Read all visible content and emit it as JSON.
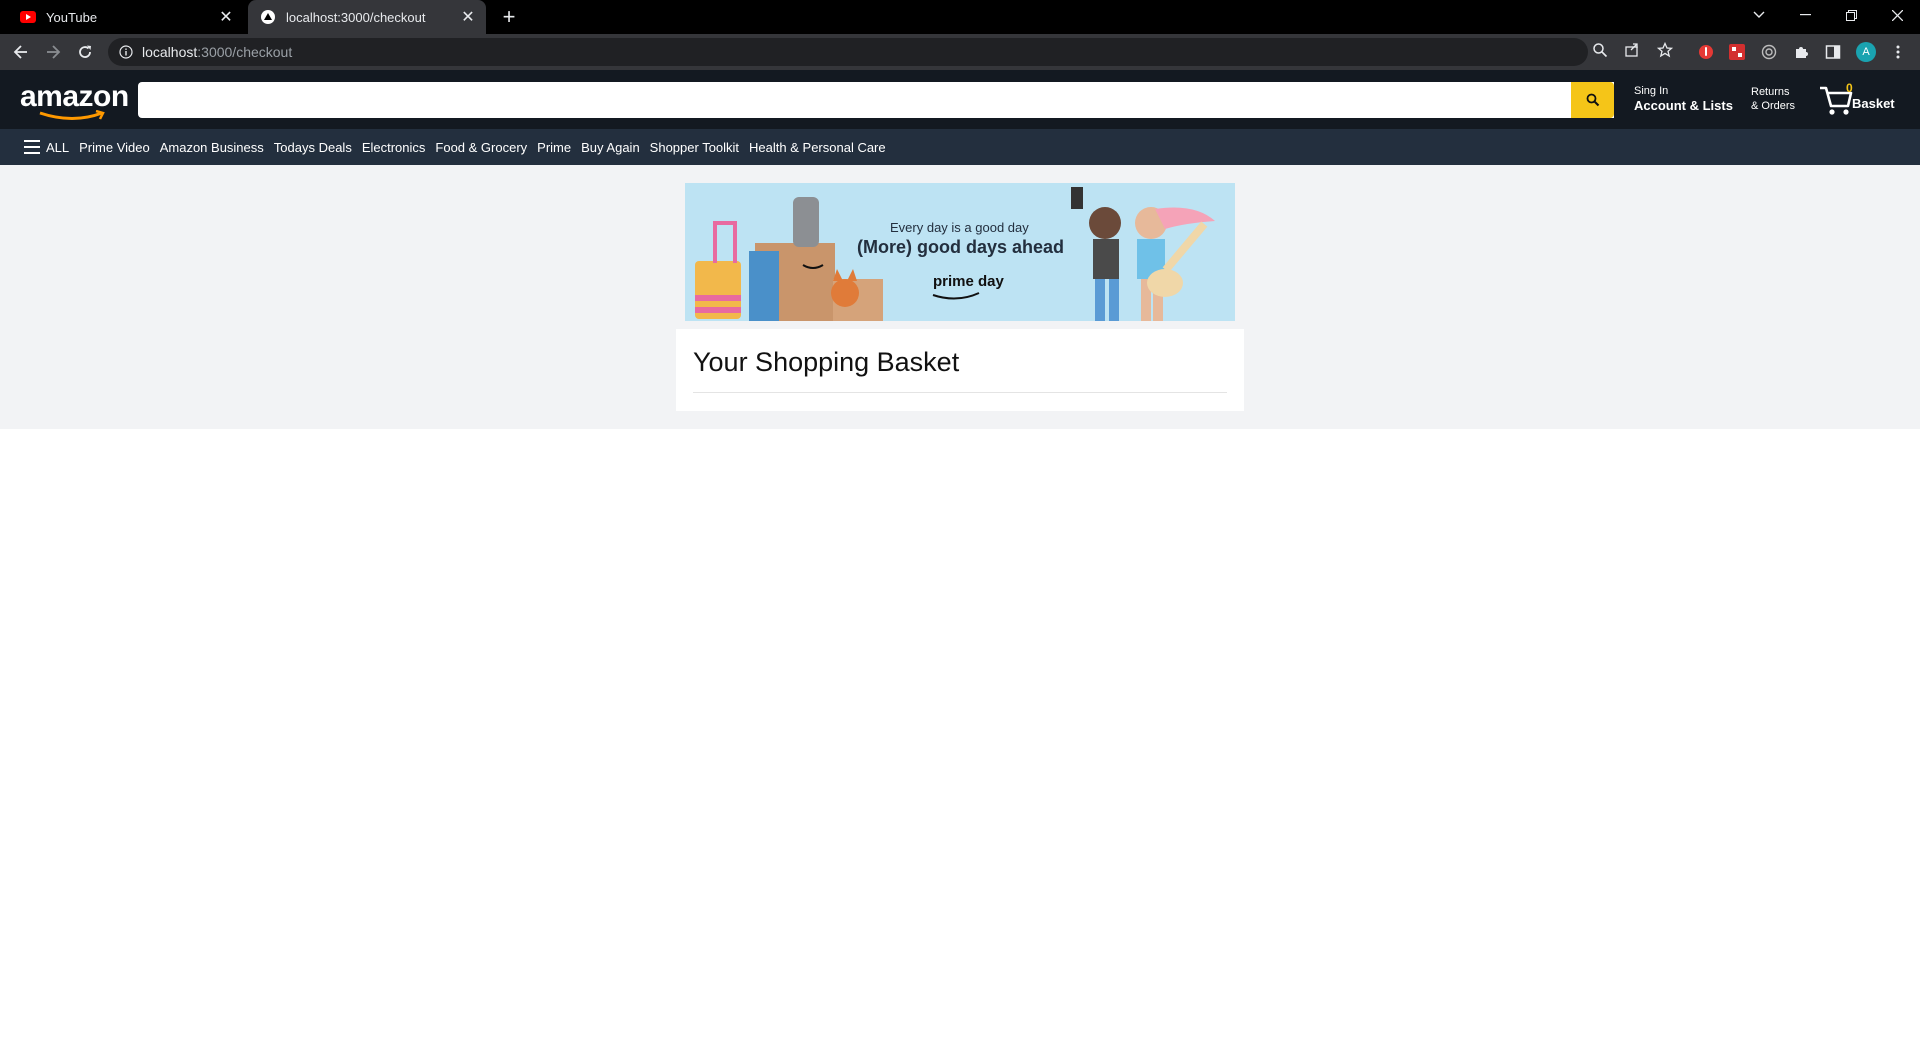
{
  "browser": {
    "tabs": [
      {
        "title": "YouTube",
        "icon": "youtube-icon",
        "active": false
      },
      {
        "title": "localhost:3000/checkout",
        "icon": "triangle-icon",
        "active": true
      }
    ],
    "new_tab_label": "+",
    "url_host": "localhost",
    "url_path": ":3000/checkout",
    "profile_initial": "A"
  },
  "header": {
    "logo_text": "amazon",
    "search_placeholder": "",
    "account": {
      "line1": "Sing In",
      "line2": "Account & Lists"
    },
    "orders": {
      "line1": "Returns",
      "line2": "& Orders"
    },
    "basket": {
      "count": "0",
      "label": "Basket"
    }
  },
  "subnav": {
    "all_label": "ALL",
    "items": [
      "Prime Video",
      "Amazon Business",
      "Todays Deals",
      "Electronics",
      "Food & Grocery",
      "Prime",
      "Buy Again",
      "Shopper Toolkit",
      "Health & Personal Care"
    ]
  },
  "banner": {
    "line1": "Every day is a good day",
    "line2": "(More) good days ahead",
    "brand": "prime day"
  },
  "checkout": {
    "title": "Your Shopping Basket"
  },
  "colors": {
    "header_bg": "#131921",
    "subnav_bg": "#232f3e",
    "search_button": "#f5c518",
    "page_bg": "#f2f3f5",
    "banner_bg": "#bde3f3"
  }
}
